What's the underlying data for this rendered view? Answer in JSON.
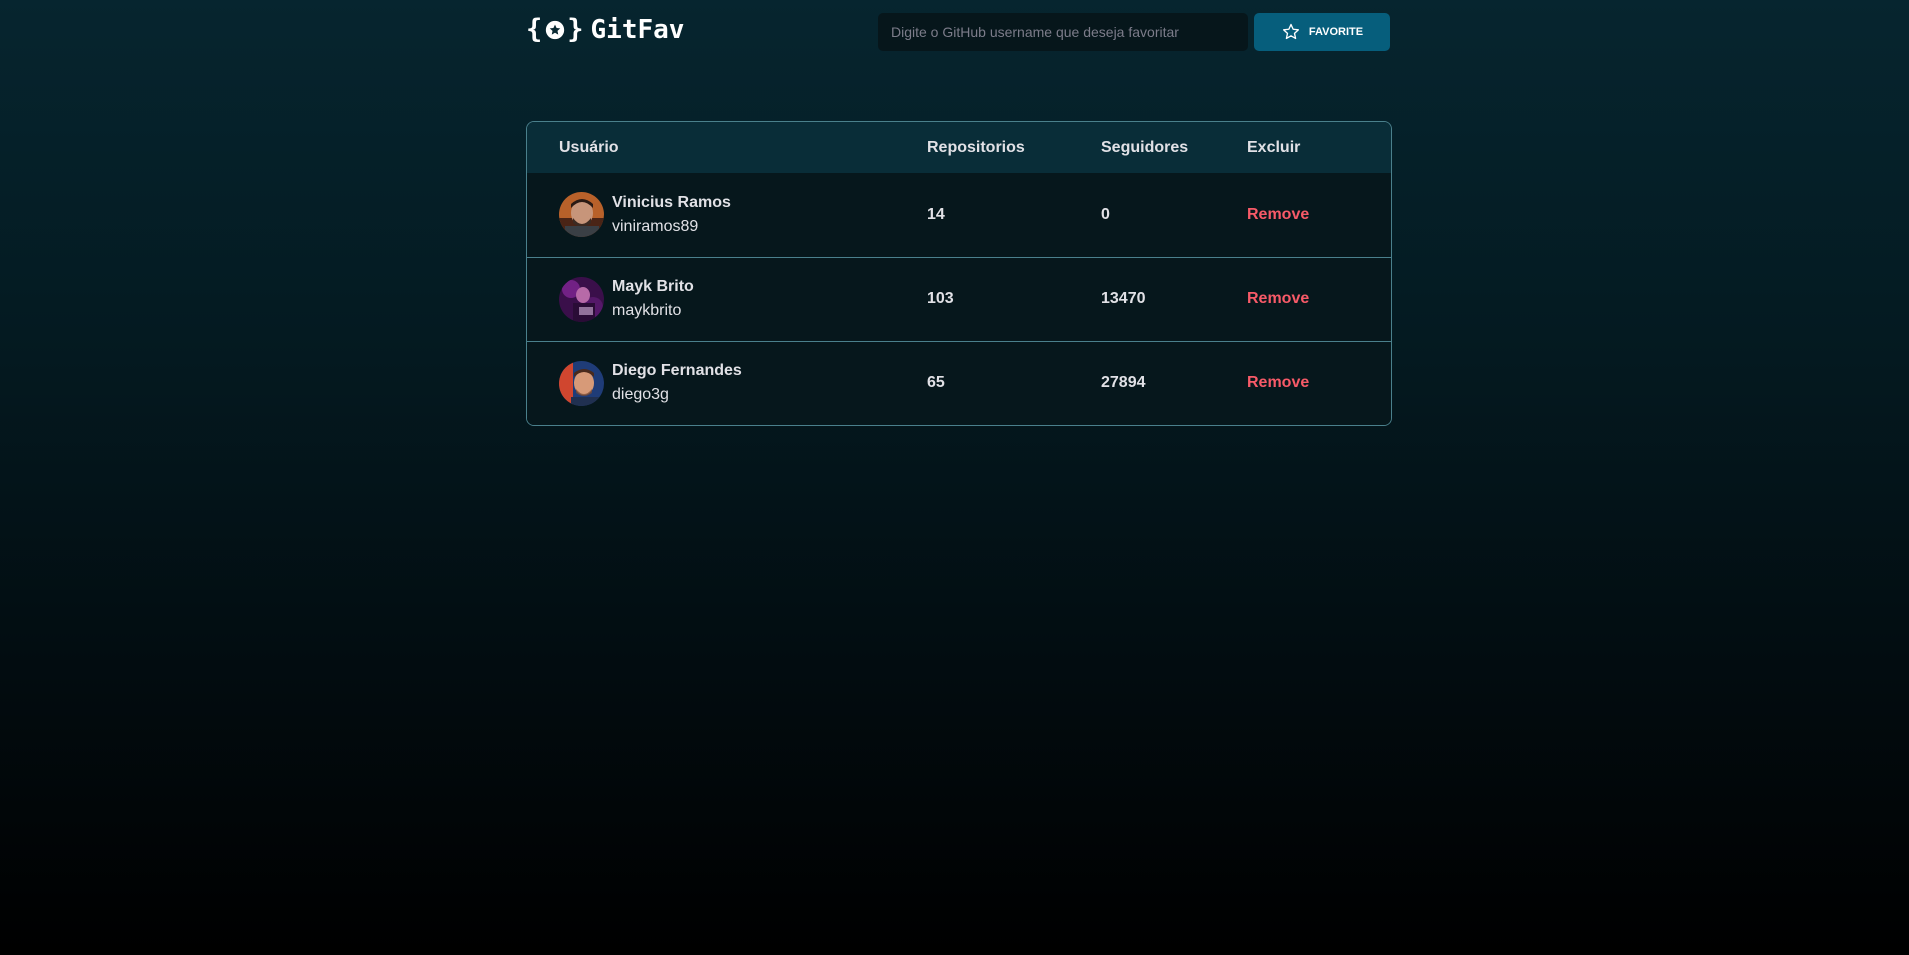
{
  "header": {
    "logo_text": "GitFav",
    "search_placeholder": "Digite o GitHub username que deseja favoritar",
    "favorite_label": "FAVORITE"
  },
  "table": {
    "columns": [
      "Usuário",
      "Repositorios",
      "Seguidores",
      "Excluir"
    ],
    "rows": [
      {
        "name": "Vinicius Ramos",
        "login": "viniramos89",
        "repositories": "14",
        "followers": "0",
        "action": "Remove"
      },
      {
        "name": "Mayk Brito",
        "login": "maykbrito",
        "repositories": "103",
        "followers": "13470",
        "action": "Remove"
      },
      {
        "name": "Diego Fernandes",
        "login": "diego3g",
        "repositories": "65",
        "followers": "27894",
        "action": "Remove"
      }
    ]
  },
  "colors": {
    "accent": "#065e7c",
    "remove": "#f75a68",
    "border": "#4a808c"
  }
}
